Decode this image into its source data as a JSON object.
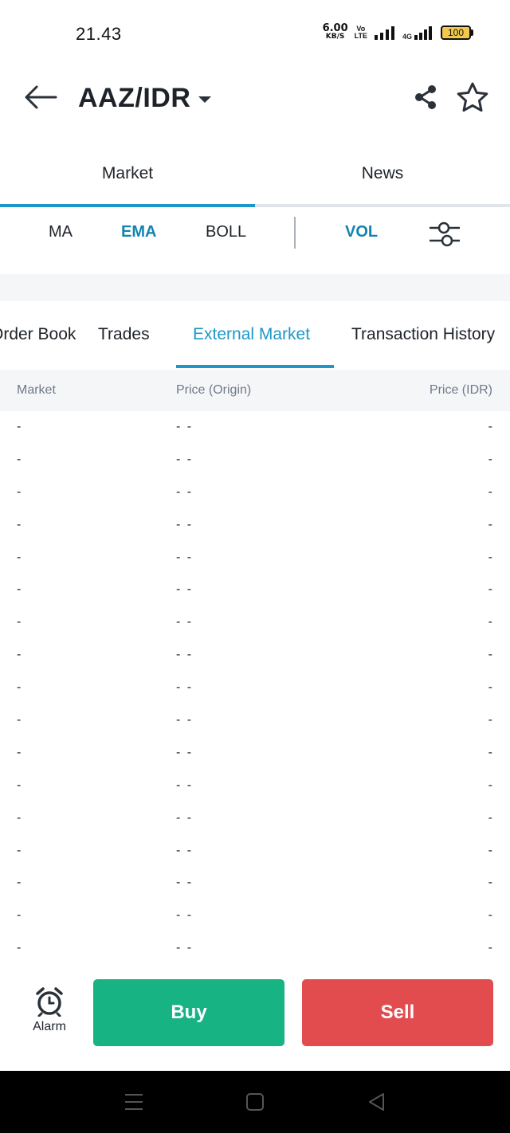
{
  "status_bar": {
    "time": "21.43",
    "net_speed": "6.00",
    "net_unit": "KB/S",
    "volte_top": "Vo",
    "volte_bottom": "LTE",
    "network": "4G",
    "battery": "100"
  },
  "header": {
    "pair": "AAZ/IDR",
    "icons": [
      "arrow-left-icon",
      "caret-down-icon",
      "share-icon",
      "star-icon"
    ]
  },
  "top_tabs": [
    {
      "label": "Market",
      "active": true
    },
    {
      "label": "News",
      "active": false
    }
  ],
  "indicators": {
    "ma": "MA",
    "ema": "EMA",
    "boll": "BOLL",
    "vol": "VOL",
    "active": [
      "EMA",
      "VOL"
    ]
  },
  "sub_tabs": [
    {
      "label": "Order Book",
      "active": false
    },
    {
      "label": "Trades",
      "active": false
    },
    {
      "label": "External Market",
      "active": true
    },
    {
      "label": "Transaction History",
      "active": false
    }
  ],
  "table": {
    "columns": [
      "Market",
      "Price (Origin)",
      "Price (IDR)"
    ],
    "rows": [
      [
        "-",
        "- -",
        "-"
      ],
      [
        "-",
        "- -",
        "-"
      ],
      [
        "-",
        "- -",
        "-"
      ],
      [
        "-",
        "- -",
        "-"
      ],
      [
        "-",
        "- -",
        "-"
      ],
      [
        "-",
        "- -",
        "-"
      ],
      [
        "-",
        "- -",
        "-"
      ],
      [
        "-",
        "- -",
        "-"
      ],
      [
        "-",
        "- -",
        "-"
      ],
      [
        "-",
        "- -",
        "-"
      ],
      [
        "-",
        "- -",
        "-"
      ],
      [
        "-",
        "- -",
        "-"
      ],
      [
        "-",
        "- -",
        "-"
      ],
      [
        "-",
        "- -",
        "-"
      ],
      [
        "-",
        "- -",
        "-"
      ],
      [
        "-",
        "- -",
        "-"
      ],
      [
        "-",
        "- -",
        "-"
      ]
    ]
  },
  "actions": {
    "alarm_label": "Alarm",
    "buy_label": "Buy",
    "sell_label": "Sell"
  },
  "colors": {
    "accent": "#1e97c8",
    "buy": "#17b383",
    "sell": "#e24c4f"
  }
}
